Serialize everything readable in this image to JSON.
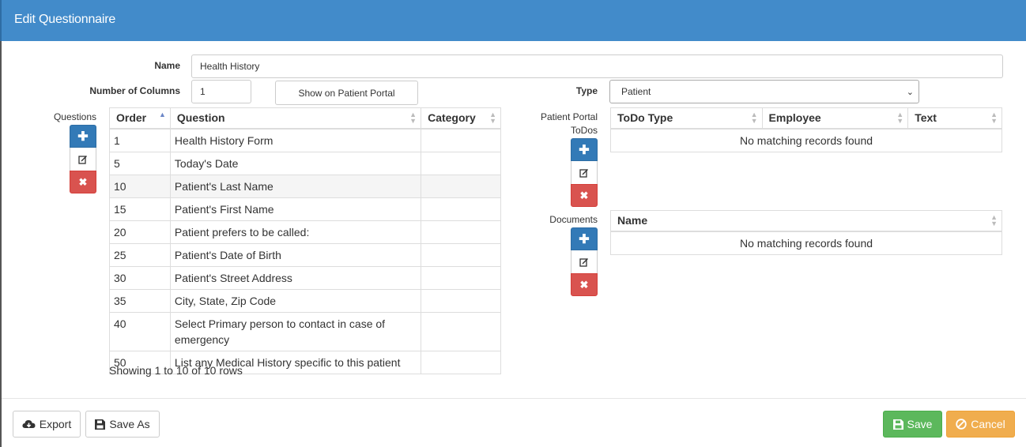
{
  "dialog": {
    "title": "Edit Questionnaire"
  },
  "form": {
    "name_label": "Name",
    "name_value": "Health History",
    "columns_label": "Number of Columns",
    "columns_value": "1",
    "portal_button": "Show on Patient Portal",
    "type_label": "Type",
    "type_value": "Patient"
  },
  "questions": {
    "label": "Questions",
    "headers": [
      "Order",
      "Question",
      "Category"
    ],
    "rows": [
      {
        "order": "1",
        "question": "Health History Form",
        "category": ""
      },
      {
        "order": "5",
        "question": "Today's Date",
        "category": ""
      },
      {
        "order": "10",
        "question": "Patient's Last Name",
        "category": ""
      },
      {
        "order": "15",
        "question": "Patient's First Name",
        "category": ""
      },
      {
        "order": "20",
        "question": "Patient prefers to be called:",
        "category": ""
      },
      {
        "order": "25",
        "question": "Patient's Date of Birth",
        "category": ""
      },
      {
        "order": "30",
        "question": "Patient's Street Address",
        "category": ""
      },
      {
        "order": "35",
        "question": "City, State, Zip Code",
        "category": ""
      },
      {
        "order": "40",
        "question": "Select Primary person to contact in case of emergency",
        "category": ""
      },
      {
        "order": "50",
        "question": "List any Medical History specific to this patient",
        "category": ""
      }
    ],
    "footer": "Showing 1 to 10 of 10 rows"
  },
  "todos": {
    "label_line1": "Patient Portal",
    "label_line2": "ToDos",
    "headers": [
      "ToDo Type",
      "Employee",
      "Text"
    ],
    "empty": "No matching records found"
  },
  "documents": {
    "label": "Documents",
    "headers": [
      "Name"
    ],
    "empty": "No matching records found"
  },
  "icons": {
    "add": "plus-icon",
    "edit": "edit-icon",
    "delete": "times-icon"
  },
  "footer": {
    "export": "Export",
    "save_as": "Save As",
    "save": "Save",
    "cancel": "Cancel"
  },
  "colors": {
    "header": "#428bca",
    "primary": "#337ab7",
    "danger": "#d9534f",
    "success": "#5cb85c",
    "warning": "#f0ad4e"
  }
}
